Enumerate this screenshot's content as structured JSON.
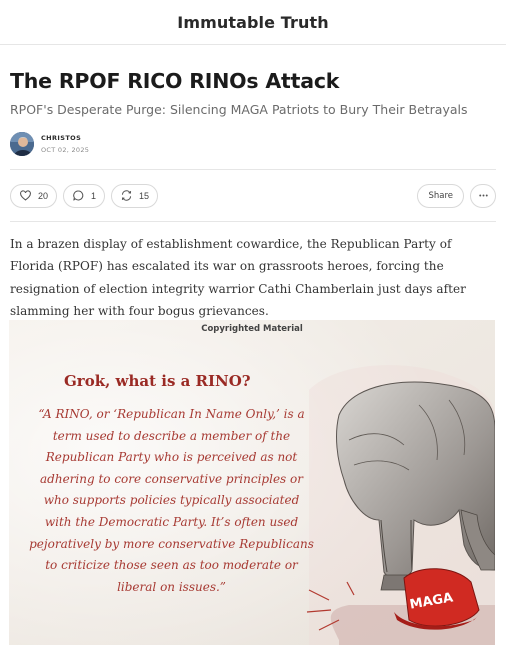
{
  "header": {
    "publication_title": "Immutable Truth"
  },
  "post": {
    "title": "The RPOF RICO RINOs Attack",
    "subtitle": "RPOF's Desperate Purge: Silencing MAGA Patriots to Bury Their Betrayals",
    "author": "CHRISTOS",
    "date": "OCT 02, 2025"
  },
  "actions": {
    "likes": "20",
    "comments": "1",
    "restacks": "15",
    "share_label": "Share"
  },
  "body": {
    "paragraph": "In a brazen display of establishment cowardice, the Republican Party of Florida (RPOF) has escalated its war on grassroots heroes, forcing the resignation of election integrity warrior Cathi Chamberlain just days after slamming her with four bogus grievances."
  },
  "figure": {
    "copyright": "Copyrighted Material",
    "heading": "Grok, what is a RINO?",
    "quote": "“A RINO, or ‘Republican In Name Only,’ is a term used to describe a member of the Republican Party who is perceived as not adhering to core conservative principles or who supports policies typically associated with the Democratic Party. It’s often used pejoratively by more conservative Republicans to criticize those seen as too moderate or liberal on issues.”",
    "hat_text": "MAGA",
    "colors": {
      "quote_red": "#a73a33",
      "hat_red": "#d02a22"
    }
  }
}
